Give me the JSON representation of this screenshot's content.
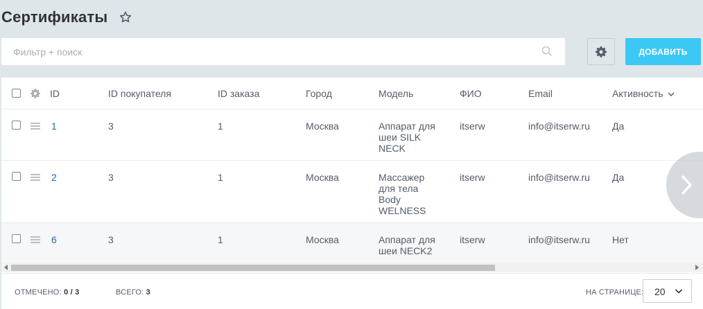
{
  "header": {
    "title": "Сертификаты"
  },
  "filter": {
    "placeholder": "Фильтр + поиск"
  },
  "toolbar": {
    "add_label": "ДОБАВИТЬ"
  },
  "columns": {
    "id": "ID",
    "buyer_id": "ID покупателя",
    "order_id": "ID заказа",
    "city": "Город",
    "model": "Модель",
    "fio": "ФИО",
    "email": "Email",
    "active": "Активность"
  },
  "rows": [
    {
      "id": "1",
      "buyer_id": "3",
      "order_id": "1",
      "city": "Москва",
      "model": "Аппарат для шеи SILK NECK",
      "fio": "itserw",
      "email": "info@itserw.ru",
      "active": "Да"
    },
    {
      "id": "2",
      "buyer_id": "3",
      "order_id": "1",
      "city": "Москва",
      "model": "Массажер для тела Body WELNESS",
      "fio": "itserw",
      "email": "info@itserw.ru",
      "active": "Да"
    },
    {
      "id": "6",
      "buyer_id": "3",
      "order_id": "1",
      "city": "Москва",
      "model": "Аппарат для шеи NECK2",
      "fio": "itserw",
      "email": "info@itserw.ru",
      "active": "Нет"
    }
  ],
  "footer": {
    "selected_label": "ОТМЕЧЕНО:",
    "selected_value": "0 / 3",
    "total_label": "ВСЕГО:",
    "total_value": "3",
    "per_page_label": "НА СТРАНИЦЕ:",
    "per_page_value": "20"
  },
  "colors": {
    "accent": "#3bc8f5",
    "link": "#2067b0",
    "background": "#dfe6ea"
  },
  "icons": [
    "star-icon",
    "search-icon",
    "gear-icon",
    "chevron-down-icon",
    "drag-handle-icon",
    "chevron-right-icon"
  ]
}
